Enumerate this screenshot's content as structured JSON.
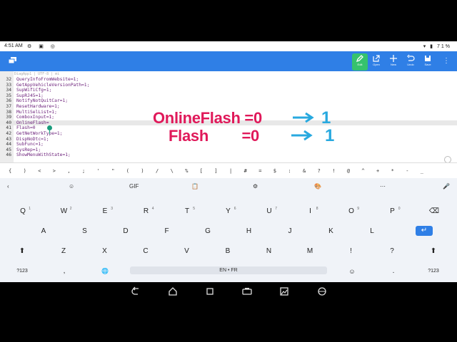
{
  "status": {
    "time": "4:51 AM",
    "battery": "71%"
  },
  "toolbar": {
    "buttons": [
      {
        "label": "Edit",
        "icon": "pencil-icon"
      },
      {
        "label": "Open",
        "icon": "open-icon"
      },
      {
        "label": "New",
        "icon": "plus-icon"
      },
      {
        "label": "Undo",
        "icon": "undo-icon"
      },
      {
        "label": "Save",
        "icon": "save-icon"
      }
    ],
    "accent": "#2f7fe6",
    "active_color": "#36c26d"
  },
  "editor": {
    "tab_header": "DiagApp1 | UTF-8 | mi",
    "lines": [
      {
        "num": "32",
        "code": "QueryInfoFromWebsite=1;"
      },
      {
        "num": "33",
        "code": "GetAppVehicleVersionPath=1;"
      },
      {
        "num": "34",
        "code": "SupWifiCfg=1;"
      },
      {
        "num": "35",
        "code": "SupRJ45=1;"
      },
      {
        "num": "36",
        "code": "NotifyNotQuitCar=1;"
      },
      {
        "num": "37",
        "code": "ResetHardware=1;"
      },
      {
        "num": "38",
        "code": "MultiSelList=1;"
      },
      {
        "num": "39",
        "code": "ComboxInput=1;"
      },
      {
        "num": "40",
        "code": "OnlineFlash=",
        "current": true
      },
      {
        "num": "41",
        "code": "Flash=0"
      },
      {
        "num": "42",
        "code": "GetNetWorkType=1;"
      },
      {
        "num": "43",
        "code": "DispNoDtc=1;"
      },
      {
        "num": "44",
        "code": "SubFunc=1;"
      },
      {
        "num": "45",
        "code": "SysRep=1;"
      },
      {
        "num": "46",
        "code": "ShowMenuWithState=1;"
      }
    ]
  },
  "annotation": {
    "line1": "OnlineFlash =0",
    "line2": "Flash        =0",
    "value1": "1",
    "value2": "1",
    "text_color": "#e0195a",
    "arrow_color": "#28a9df"
  },
  "symbols": [
    "{",
    ")",
    "<",
    ">",
    ",",
    ";",
    "'",
    "\"",
    "(",
    ")",
    "/",
    "\\",
    "%",
    "[",
    "]",
    "|",
    "#",
    "=",
    "$",
    ":",
    "&",
    "?",
    "!",
    "@",
    "^",
    "+",
    "*",
    "-",
    "_"
  ],
  "keyboard": {
    "suggestions": [
      {
        "name": "back-chevron-icon",
        "text": "‹"
      },
      {
        "name": "emoji-sticker-icon",
        "text": "☺"
      },
      {
        "name": "gif-button",
        "text": "GIF"
      },
      {
        "name": "clipboard-icon",
        "text": "📋"
      },
      {
        "name": "settings-icon",
        "text": "⚙"
      },
      {
        "name": "palette-icon",
        "text": "🎨"
      },
      {
        "name": "more-icon",
        "text": "⋯"
      },
      {
        "name": "mic-icon",
        "text": "🎤"
      }
    ],
    "row1": [
      {
        "k": "Q",
        "n": "1"
      },
      {
        "k": "W",
        "n": "2"
      },
      {
        "k": "E",
        "n": "3"
      },
      {
        "k": "R",
        "n": "4"
      },
      {
        "k": "T",
        "n": "5"
      },
      {
        "k": "Y",
        "n": "6"
      },
      {
        "k": "U",
        "n": "7"
      },
      {
        "k": "I",
        "n": "8"
      },
      {
        "k": "O",
        "n": "9"
      },
      {
        "k": "P",
        "n": "0"
      }
    ],
    "row2": [
      "A",
      "S",
      "D",
      "F",
      "G",
      "H",
      "J",
      "K",
      "L"
    ],
    "row3": [
      "Z",
      "X",
      "C",
      "V",
      "B",
      "N",
      "M",
      "!",
      "?"
    ],
    "bottom": {
      "sym": "?123",
      "comma": ",",
      "globe": "🌐",
      "space": "EN • FR",
      "emoji": "☺",
      "period": ".",
      "sym_right": "?123"
    }
  }
}
